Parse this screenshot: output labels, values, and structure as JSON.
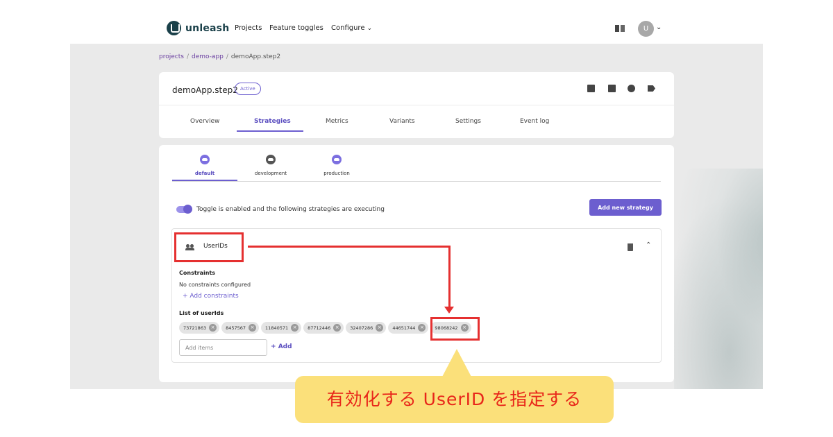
{
  "app": {
    "name": "unleash"
  },
  "nav": {
    "projects": "Projects",
    "feature_toggles": "Feature toggles",
    "configure": "Configure",
    "avatar_initial": "U"
  },
  "breadcrumb": {
    "project_root": "projects",
    "project": "demo-app",
    "feature": "demoApp.step2"
  },
  "feature": {
    "name": "demoApp.step2",
    "status": "Active"
  },
  "tabs": [
    "Overview",
    "Strategies",
    "Metrics",
    "Variants",
    "Settings",
    "Event log"
  ],
  "selected_tab": "Strategies",
  "environments": [
    {
      "name": "default",
      "enabled": true,
      "selected": true
    },
    {
      "name": "development",
      "enabled": false,
      "selected": false
    },
    {
      "name": "production",
      "enabled": true,
      "selected": false
    }
  ],
  "toggle": {
    "enabled": true,
    "text": "Toggle is enabled and the following strategies are executing"
  },
  "add_strategy_label": "Add new strategy",
  "strategy": {
    "name": "UserIDs",
    "constraints_heading": "Constraints",
    "no_constraints_text": "No constraints configured",
    "add_constraints_label": "+ Add constraints",
    "user_ids_heading": "List of userIds",
    "user_ids": [
      "73721863",
      "8457567",
      "11840571",
      "87712446",
      "32407286",
      "44651744",
      "98068242"
    ],
    "add_items_placeholder": "Add items",
    "add_label": "Add"
  },
  "annotation": {
    "callout_text": "有効化する UserID を指定する",
    "highlight_color": "#e53030",
    "callout_color": "#fbe07a"
  },
  "colors": {
    "accent": "#6c5ecf",
    "brand": "#1a4049"
  }
}
